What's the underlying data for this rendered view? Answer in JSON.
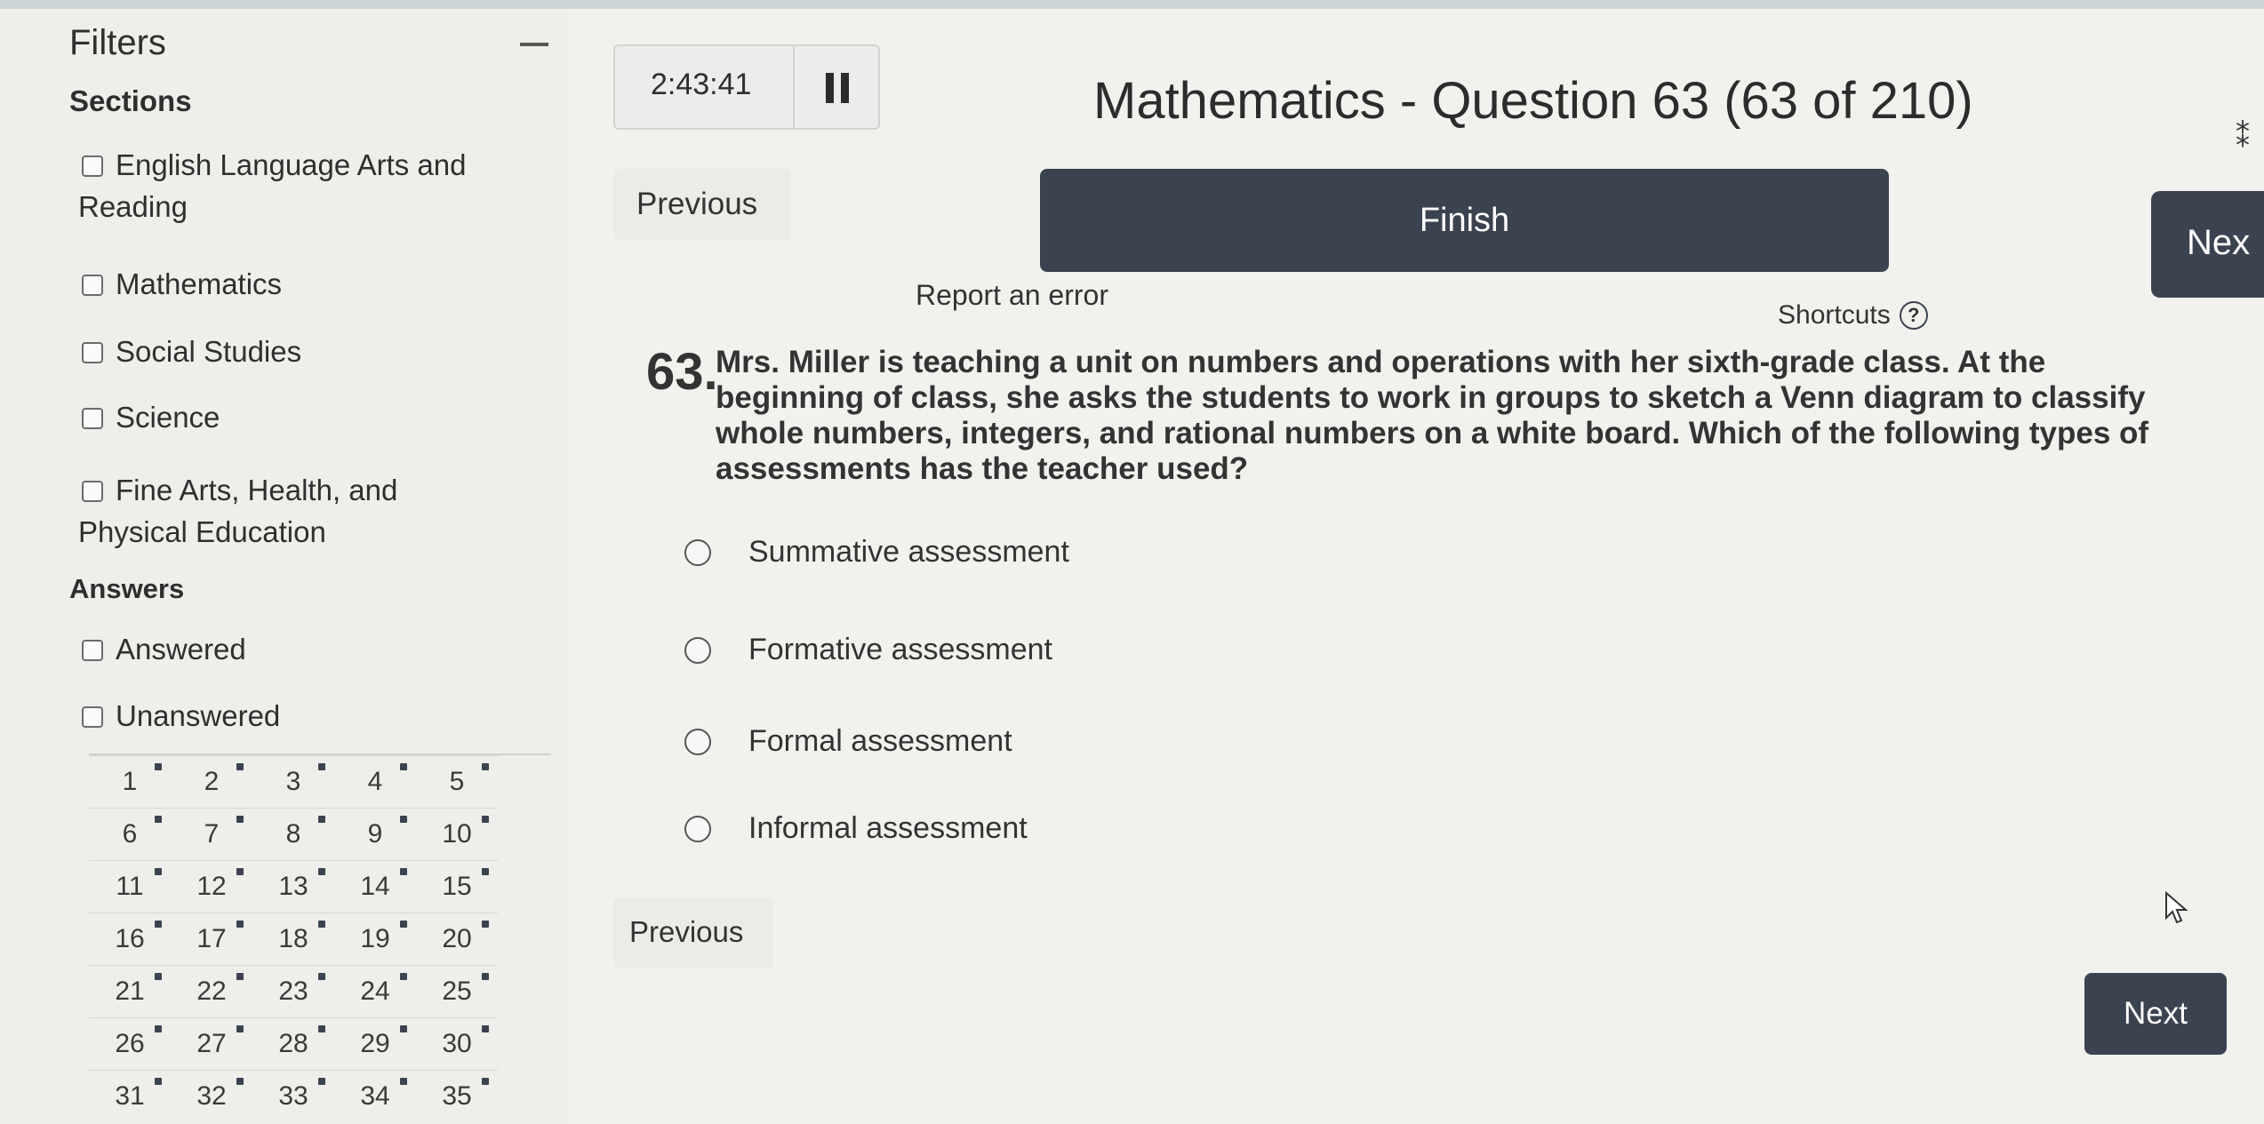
{
  "sidebar": {
    "title": "Filters",
    "collapse_symbol": "—",
    "sections_heading": "Sections",
    "sections": [
      {
        "label": "English Language Arts and"
      },
      {
        "label": "Reading"
      },
      {
        "label": "Mathematics"
      },
      {
        "label": "Social Studies"
      },
      {
        "label": "Science"
      },
      {
        "label": "Fine Arts, Health, and"
      },
      {
        "label": "Physical Education"
      }
    ],
    "answers_heading": "Answers",
    "answers": [
      {
        "label": "Answered"
      },
      {
        "label": "Unanswered"
      }
    ],
    "question_grid": [
      [
        "1",
        "2",
        "3",
        "4",
        "5"
      ],
      [
        "6",
        "7",
        "8",
        "9",
        "10"
      ],
      [
        "11",
        "12",
        "13",
        "14",
        "15"
      ],
      [
        "16",
        "17",
        "18",
        "19",
        "20"
      ],
      [
        "21",
        "22",
        "23",
        "24",
        "25"
      ],
      [
        "26",
        "27",
        "28",
        "29",
        "30"
      ],
      [
        "31",
        "32",
        "33",
        "34",
        "35"
      ]
    ]
  },
  "timer": {
    "value": "2:43:41",
    "pause_icon": "pause-icon"
  },
  "header": {
    "question_title": "Mathematics - Question 63 (63 of 210)",
    "previous_label": "Previous",
    "finish_label": "Finish",
    "next_label": "Nex",
    "report_label": "Report an error",
    "shortcuts_label": "Shortcuts",
    "help_symbol": "?"
  },
  "question": {
    "number": "63.",
    "text": "Mrs. Miller is teaching a unit on numbers and operations with her sixth-grade class. At the beginning of class, she asks the students to work in groups to sketch a Venn diagram to classify whole numbers, integers, and rational numbers on a white board. Which of the following types of assessments has the teacher used?",
    "options": [
      "Summative assessment",
      "Formative assessment",
      "Formal assessment",
      "Informal assessment"
    ]
  },
  "footer": {
    "previous_label": "Previous",
    "next_label": "Next"
  },
  "colors": {
    "dark_button": "#3b4350",
    "background": "#f1f1ee"
  }
}
